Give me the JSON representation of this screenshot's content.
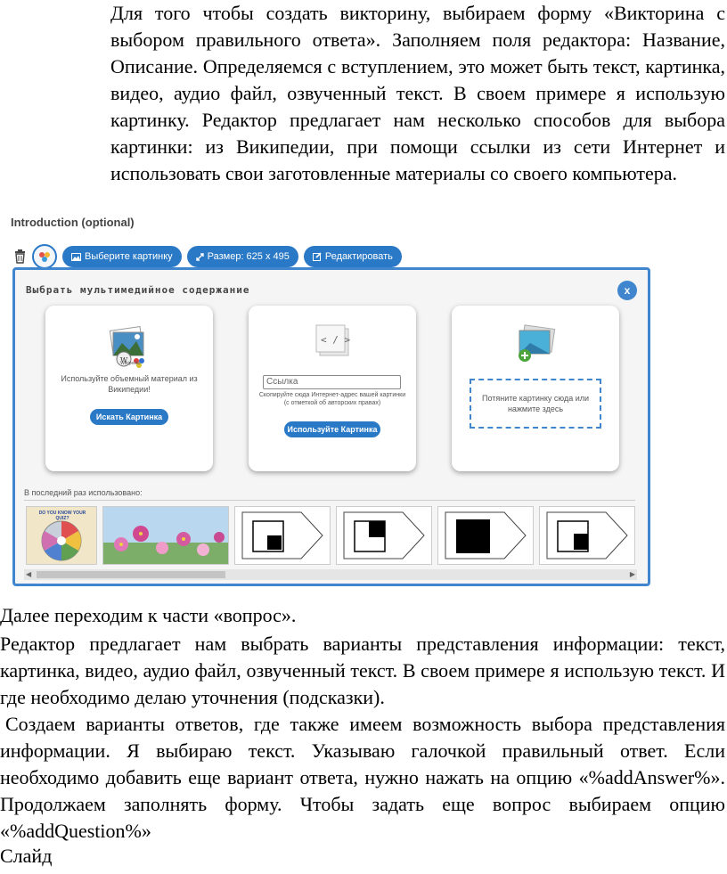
{
  "text": {
    "p1": "Для того чтобы создать викторину, выбираем форму «Викторина с выбором правильного ответа». Заполняем поля редактора: Название, Описание. Определяемся с вступлением, это может быть текст, картинка, видео, аудио файл, озвученный текст. В своем примере я использую картинку. Редактор предлагает нам несколько способов для выбора картинки: из Википедии, при помощи ссылки из сети Интернет и использовать свои заготовленные материалы со своего компьютера.",
    "p2": "Далее переходим к части «вопрос».",
    "p3": "Редактор предлагает нам выбрать варианты представления информации: текст, картинка, видео, аудио файл, озвученный текст. В своем примере я использую текст. И где необходимо делаю уточнения (подсказки).",
    "p4": "Создаем варианты ответов, где также имеем возможность выбора представления информации. Я выбираю текст. Указываю галочкой правильный ответ. Если необходимо добавить еще вариант ответа, нужно нажать на опцию «%addAnswer%». Продолжаем заполнять форму. Чтобы задать еще вопрос выбираем опцию «%addQuestion%»",
    "p5": "Слайд"
  },
  "editor": {
    "intro_label": "Introduction (optional)",
    "toolbar": {
      "choose_image": "Выберите картинку",
      "size": "Размер: 625 x 495",
      "edit": "Редактировать"
    },
    "modal": {
      "title": "Выбрать мультимедийное содержание",
      "close": "x",
      "wiki": {
        "text": "Используйте объемный материал из Википедии!",
        "button": "Искать Картинка",
        "logo_label": "Wikipedia"
      },
      "url": {
        "placeholder": "Ссылка",
        "hint": "Скопируйте сюда Интернет-адрес вашей картинки (с отметкой об авторских правах)",
        "button": "Используйте Картинка",
        "icon_glyph": "< / >"
      },
      "upload": {
        "drop_text": "Потяните картинку сюда или нажмите здесь"
      },
      "recent_label": "В последний раз использовано:",
      "thumb1_caption": "DO YOU KNOW YOUR QUIZ?"
    }
  },
  "colors": {
    "accent": "#2a79c6",
    "modal_border": "#3f86cf"
  }
}
